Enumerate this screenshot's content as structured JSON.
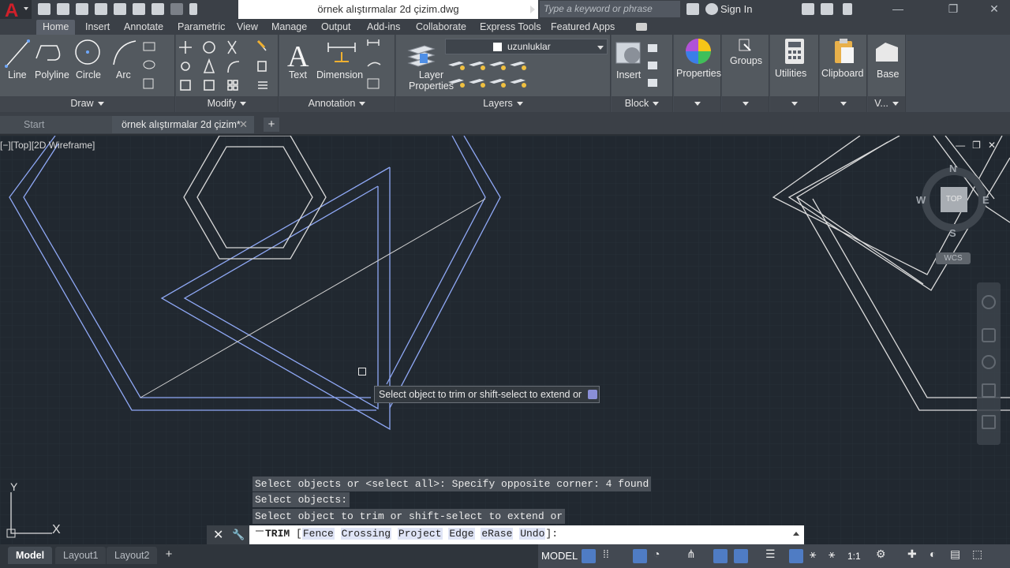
{
  "app": {
    "title": "örnek alıştırmalar 2d çizim.dwg",
    "search_placeholder": "Type a keyword or phrase",
    "sign_in": "Sign In",
    "brand_color": "#d0202a"
  },
  "ribbon_tabs": [
    "Home",
    "Insert",
    "Annotate",
    "Parametric",
    "View",
    "Manage",
    "Output",
    "Add-ins",
    "Collaborate",
    "Express Tools",
    "Featured Apps"
  ],
  "ribbon": {
    "draw": {
      "title": "Draw",
      "tools": [
        "Line",
        "Polyline",
        "Circle",
        "Arc"
      ]
    },
    "modify": {
      "title": "Modify"
    },
    "annotation": {
      "title": "Annotation",
      "tools": [
        "Text",
        "Dimension"
      ]
    },
    "layers": {
      "title": "Layers",
      "layer_props_line1": "Layer",
      "layer_props_line2": "Properties",
      "current_layer": "uzunluklar"
    },
    "block": {
      "title": "Block",
      "insert": "Insert"
    },
    "properties": "Properties",
    "groups": "Groups",
    "utilities": "Utilities",
    "clipboard": "Clipboard",
    "base": "Base",
    "view_short": "V..."
  },
  "file_tabs": {
    "start": "Start",
    "document": "örnek alıştırmalar 2d çizim*",
    "close": "✕",
    "add": "+"
  },
  "viewport": {
    "label": "[−][Top][2D Wireframe]",
    "tooltip": "Select object to trim or shift-select to extend or",
    "viewcube": {
      "n": "N",
      "s": "S",
      "e": "E",
      "w": "W",
      "face": "TOP",
      "wcs": "WCS"
    },
    "ucs_x": "X",
    "ucs_y": "Y",
    "selection_color": "#7f9cf5",
    "line_color": "#e8e8e8"
  },
  "command_history": [
    "Select objects or <select all>: Specify opposite corner: 4 found",
    "Select objects:",
    "Select object to trim or shift-select to extend or"
  ],
  "command_line": {
    "command": "TRIM",
    "open_bracket": "[",
    "options": [
      "Fence",
      "Crossing",
      "Project",
      "Edge",
      "eRase",
      "Undo"
    ],
    "close": "]:"
  },
  "layout_tabs": [
    "Model",
    "Layout1",
    "Layout2"
  ],
  "status": {
    "model": "MODEL",
    "scale": "1:1"
  }
}
